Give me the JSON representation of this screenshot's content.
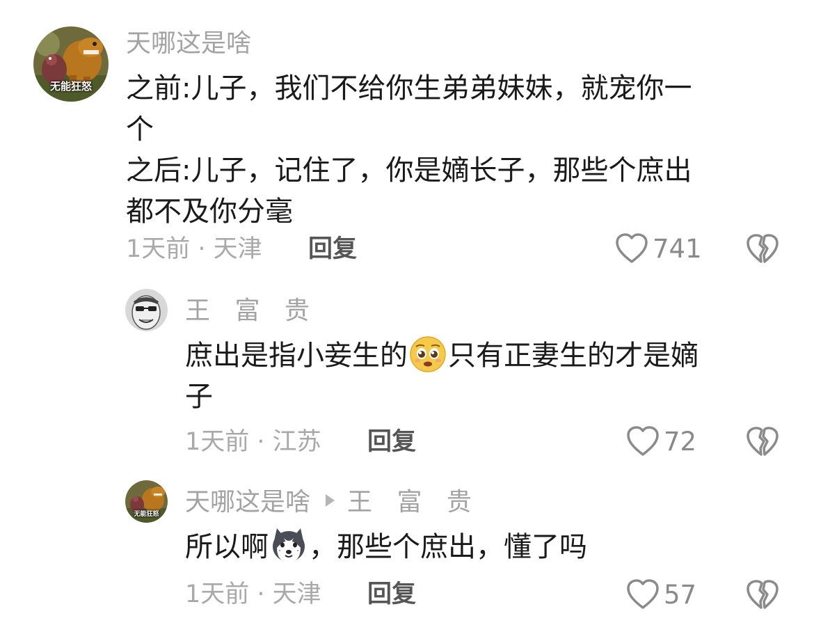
{
  "comments": [
    {
      "username": "天哪这是啥",
      "avatar_caption": "无能狂怒",
      "lines": [
        "之前:儿子，我们不给你生弟弟妹妹，就宠你一",
        "个",
        "之后:儿子，记住了，你是嫡长子，那些个庶出",
        "都不及你分毫"
      ],
      "meta": "1天前 · 天津",
      "reply_label": "回复",
      "likes": "741"
    },
    {
      "username": "王 富 贵",
      "text_before_emoji": "庶出是指小妾生的",
      "emoji": "pleading-face-emoji",
      "text_after_emoji": "只有正妻生的才是嫡",
      "line2": "子",
      "meta": "1天前 · 江苏",
      "reply_label": "回复",
      "likes": "72"
    },
    {
      "username": "天哪这是啥",
      "avatar_caption": "无能狂怒",
      "reply_to": "王 富 贵",
      "text_before_emoji": "所以啊",
      "emoji": "husky-dog-emoji",
      "text_after_emoji": "，那些个庶出，懂了吗",
      "meta": "1天前 · 天津",
      "reply_label": "回复",
      "likes": "57"
    }
  ],
  "icons": {
    "like": "heart-outline-icon",
    "dislike": "broken-heart-icon",
    "reply_arrow": "right-triangle-icon"
  },
  "colors": {
    "username": "#a3a3a3",
    "text": "#1a1a1a",
    "meta": "#a9a9a9",
    "reply": "#555555",
    "icon": "#8a8a8a"
  }
}
